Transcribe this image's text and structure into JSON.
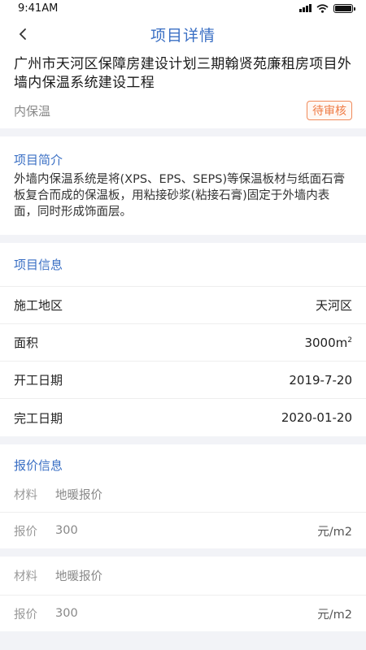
{
  "status": {
    "time": "9:41AM"
  },
  "nav": {
    "title": "项目详情"
  },
  "project": {
    "title": "广州市天河区保障房建设计划三期翰贤苑廉租房项目外墙内保温系统建设工程",
    "type": "内保温",
    "badge": "待审核"
  },
  "intro": {
    "title": "项目简介",
    "text": "外墙内保温系统是将(XPS、EPS、SEPS)等保温板材与纸面石膏板复合而成的保温板，用粘接砂浆(粘接石膏)固定于外墙内表面，同时形成饰面层。"
  },
  "info": {
    "title": "项目信息",
    "rows": [
      {
        "label": "施工地区",
        "value": "天河区"
      },
      {
        "label": "面积",
        "value": "3000m",
        "sup": "2"
      },
      {
        "label": "开工日期",
        "value": "2019-7-20"
      },
      {
        "label": "完工日期",
        "value": "2020-01-20"
      }
    ]
  },
  "quotes": {
    "title": "报价信息",
    "items": [
      {
        "material_label": "材料",
        "material": "地暖报价",
        "price_label": "报价",
        "price": "300",
        "unit": "元/m2"
      },
      {
        "material_label": "材料",
        "material": "地暖报价",
        "price_label": "报价",
        "price": "300",
        "unit": "元/m2"
      }
    ]
  }
}
